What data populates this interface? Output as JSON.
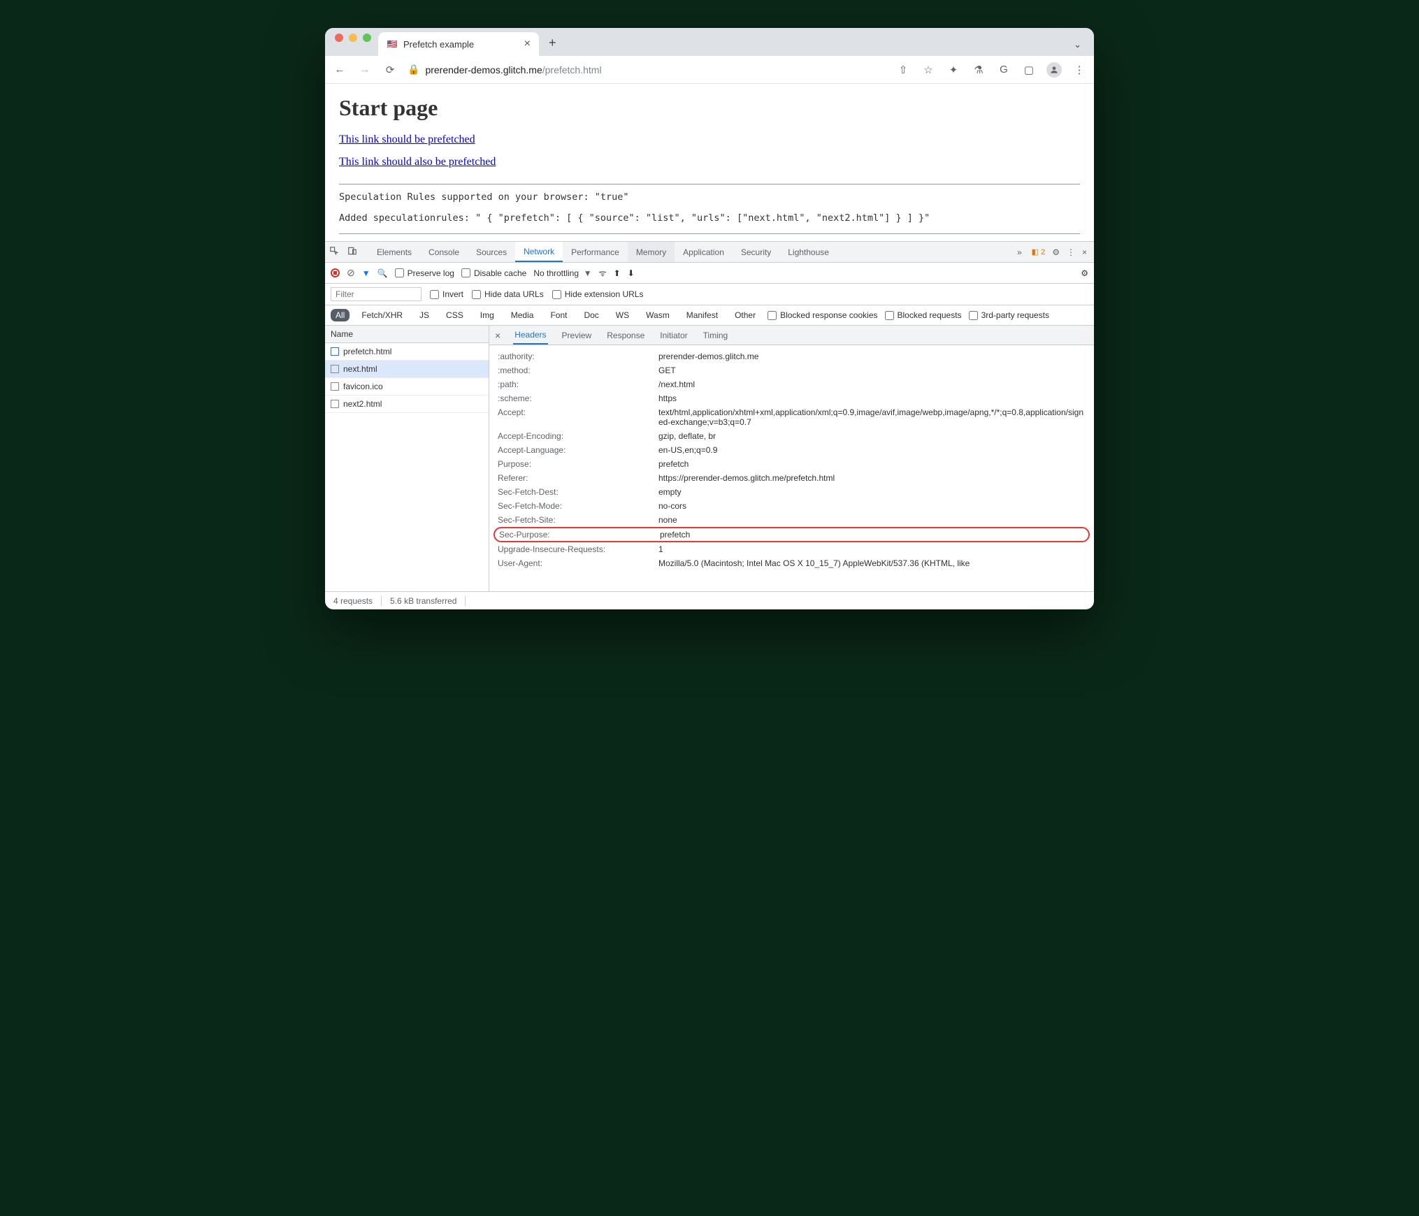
{
  "chrome": {
    "tab_title": "Prefetch example",
    "url_display_host": "prerender-demos.glitch.me",
    "url_display_path": "/prefetch.html"
  },
  "page": {
    "h1": "Start page",
    "link1": "This link should be prefetched",
    "link2": "This link should also be prefetched",
    "status1": "Speculation Rules supported on your browser: \"true\"",
    "status2": "Added speculationrules: \" { \"prefetch\": [ { \"source\": \"list\", \"urls\": [\"next.html\", \"next2.html\"] } ] }\""
  },
  "devtools": {
    "tabs": {
      "elements": "Elements",
      "console": "Console",
      "sources": "Sources",
      "network": "Network",
      "performance": "Performance",
      "memory": "Memory",
      "application": "Application",
      "security": "Security",
      "lighthouse": "Lighthouse"
    },
    "warn_count": "2",
    "net_toolbar": {
      "preserve": "Preserve log",
      "disable_cache": "Disable cache",
      "throttling": "No throttling"
    },
    "filters": {
      "placeholder": "Filter",
      "invert": "Invert",
      "hide_data": "Hide data URLs",
      "hide_ext": "Hide extension URLs",
      "types": [
        "All",
        "Fetch/XHR",
        "JS",
        "CSS",
        "Img",
        "Media",
        "Font",
        "Doc",
        "WS",
        "Wasm",
        "Manifest",
        "Other"
      ],
      "blocked_cookies": "Blocked response cookies",
      "blocked_req": "Blocked requests",
      "third_party": "3rd-party requests"
    },
    "req_header": "Name",
    "requests": [
      {
        "name": "prefetch.html",
        "type": "doc"
      },
      {
        "name": "next.html",
        "type": "plain",
        "selected": true
      },
      {
        "name": "favicon.ico",
        "type": "plain"
      },
      {
        "name": "next2.html",
        "type": "plain"
      }
    ],
    "detail_tabs": {
      "headers": "Headers",
      "preview": "Preview",
      "response": "Response",
      "initiator": "Initiator",
      "timing": "Timing"
    },
    "headers": [
      {
        "k": ":authority:",
        "v": "prerender-demos.glitch.me"
      },
      {
        "k": ":method:",
        "v": "GET"
      },
      {
        "k": ":path:",
        "v": "/next.html"
      },
      {
        "k": ":scheme:",
        "v": "https"
      },
      {
        "k": "Accept:",
        "v": "text/html,application/xhtml+xml,application/xml;q=0.9,image/avif,image/webp,image/apng,*/*;q=0.8,application/signed-exchange;v=b3;q=0.7"
      },
      {
        "k": "Accept-Encoding:",
        "v": "gzip, deflate, br"
      },
      {
        "k": "Accept-Language:",
        "v": "en-US,en;q=0.9"
      },
      {
        "k": "Purpose:",
        "v": "prefetch"
      },
      {
        "k": "Referer:",
        "v": "https://prerender-demos.glitch.me/prefetch.html"
      },
      {
        "k": "Sec-Fetch-Dest:",
        "v": "empty"
      },
      {
        "k": "Sec-Fetch-Mode:",
        "v": "no-cors"
      },
      {
        "k": "Sec-Fetch-Site:",
        "v": "none"
      },
      {
        "k": "Sec-Purpose:",
        "v": "prefetch",
        "highlight": true
      },
      {
        "k": "Upgrade-Insecure-Requests:",
        "v": "1"
      },
      {
        "k": "User-Agent:",
        "v": "Mozilla/5.0 (Macintosh; Intel Mac OS X 10_15_7) AppleWebKit/537.36 (KHTML, like"
      }
    ],
    "status_bar": {
      "requests": "4 requests",
      "transferred": "5.6 kB transferred"
    }
  }
}
